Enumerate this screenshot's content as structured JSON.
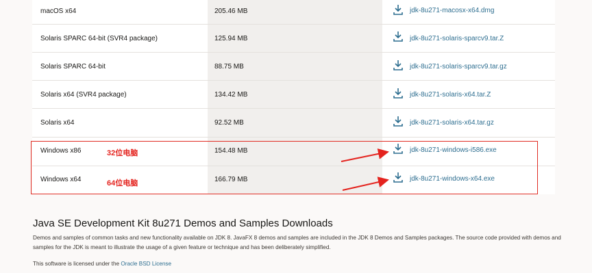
{
  "rows": [
    {
      "name": "macOS x64",
      "size": "205.46 MB",
      "file": "jdk-8u271-macosx-x64.dmg"
    },
    {
      "name": "Solaris SPARC 64-bit (SVR4 package)",
      "size": "125.94 MB",
      "file": "jdk-8u271-solaris-sparcv9.tar.Z"
    },
    {
      "name": "Solaris SPARC 64-bit",
      "size": "88.75 MB",
      "file": "jdk-8u271-solaris-sparcv9.tar.gz"
    },
    {
      "name": "Solaris x64 (SVR4 package)",
      "size": "134.42 MB",
      "file": "jdk-8u271-solaris-x64.tar.Z"
    },
    {
      "name": "Solaris x64",
      "size": "92.52 MB",
      "file": "jdk-8u271-solaris-x64.tar.gz"
    },
    {
      "name": "Windows x86",
      "size": "154.48 MB",
      "file": "jdk-8u271-windows-i586.exe"
    },
    {
      "name": "Windows x64",
      "size": "166.79 MB",
      "file": "jdk-8u271-windows-x64.exe"
    }
  ],
  "annotations": {
    "x86_note": "32位电脑",
    "x64_note": "64位电脑"
  },
  "colors": {
    "link": "#2c6d8f",
    "annotation_red": "#e4231e"
  },
  "icons": {
    "download": "download-icon"
  },
  "demos": {
    "title": "Java SE Development Kit 8u271 Demos and Samples Downloads",
    "description": "Demos and samples of common tasks and new functionality available on JDK 8. JavaFX 8 demos and samples are included in the JDK 8 Demos and Samples packages. The source code provided with demos and samples for the JDK is meant to illustrate the usage of a given feature or technique and has been deliberately simplified.",
    "license_prefix": "This software is licensed under the ",
    "license_link": "Oracle BSD License"
  }
}
